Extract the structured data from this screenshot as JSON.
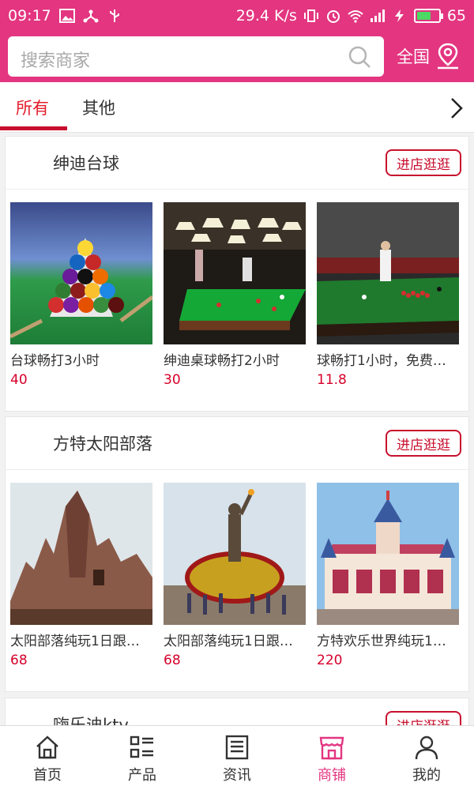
{
  "status_bar": {
    "time": "09:17",
    "network_speed": "29.4 K/s",
    "battery": "65",
    "battery_fraction": 0.65
  },
  "search": {
    "placeholder": "搜索商家",
    "region_label": "全国"
  },
  "tabs": [
    {
      "label": "所有",
      "active": true
    },
    {
      "label": "其他",
      "active": false
    }
  ],
  "stores": [
    {
      "name": "绅迪台球",
      "visit_label": "进店逛逛",
      "products": [
        {
          "name": "台球畅打3小时",
          "price": "40"
        },
        {
          "name": "绅迪桌球畅打2小时",
          "price": "30"
        },
        {
          "name": "球畅打1小时，免费…",
          "price": "11.8"
        }
      ]
    },
    {
      "name": "方特太阳部落",
      "visit_label": "进店逛逛",
      "products": [
        {
          "name": "太阳部落纯玩1日跟…",
          "price": "68"
        },
        {
          "name": "太阳部落纯玩1日跟…",
          "price": "68"
        },
        {
          "name": "方特欢乐世界纯玩1…",
          "price": "220"
        }
      ]
    },
    {
      "name": "嗨乐迪ktv",
      "visit_label": "进店逛逛",
      "products": []
    }
  ],
  "bottom_nav": [
    {
      "label": "首页",
      "icon": "home-icon"
    },
    {
      "label": "产品",
      "icon": "grid-list-icon"
    },
    {
      "label": "资讯",
      "icon": "news-icon"
    },
    {
      "label": "商铺",
      "icon": "store-icon",
      "active": true
    },
    {
      "label": "我的",
      "icon": "user-icon"
    }
  ],
  "colors": {
    "brand": "#e33580",
    "accent_red": "#c8102e",
    "price_red": "#d6002a"
  }
}
